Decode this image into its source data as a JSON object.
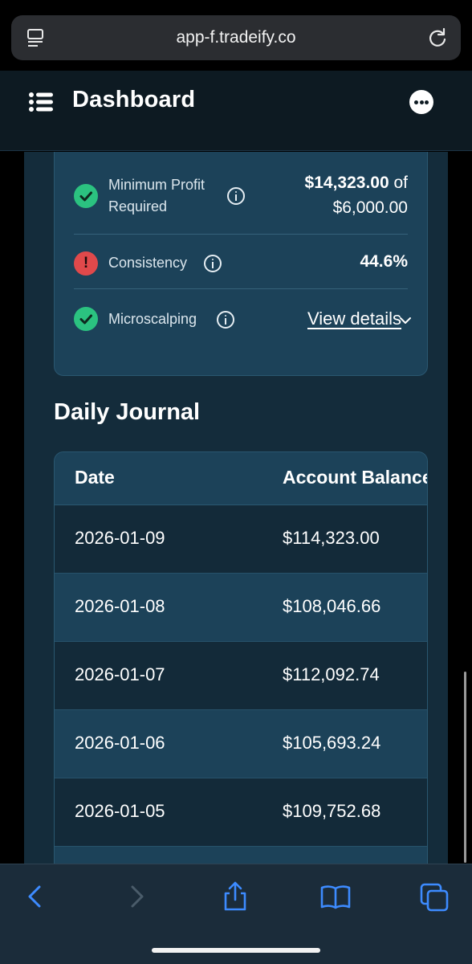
{
  "browser": {
    "url": "app-f.tradeify.co",
    "accent_color": "#3d8bff"
  },
  "header": {
    "title": "Dashboard"
  },
  "rules": [
    {
      "label_line1": "Minimum Profit",
      "label_line2": "Required",
      "status": "pass",
      "value_bold": "$14,323.00",
      "value_rest": " of",
      "value_line2": "$6,000.00"
    },
    {
      "label": "Consistency",
      "status": "fail",
      "status_glyph": "!",
      "value": "44.6%"
    },
    {
      "label": "Microscalping",
      "status": "pass",
      "link": "View details"
    }
  ],
  "journal": {
    "title": "Daily Journal",
    "columns": [
      "Date",
      "Account Balance"
    ],
    "rows": [
      {
        "date": "2026-01-09",
        "balance": "$114,323.00"
      },
      {
        "date": "2026-01-08",
        "balance": "$108,046.66"
      },
      {
        "date": "2026-01-07",
        "balance": "$112,092.74"
      },
      {
        "date": "2026-01-06",
        "balance": "$105,693.24"
      },
      {
        "date": "2026-01-05",
        "balance": "$109,752.68"
      }
    ]
  },
  "colors": {
    "pass": "#2bc280",
    "fail": "#e0494b",
    "card": "#1c4259",
    "background": "#142c3b"
  }
}
